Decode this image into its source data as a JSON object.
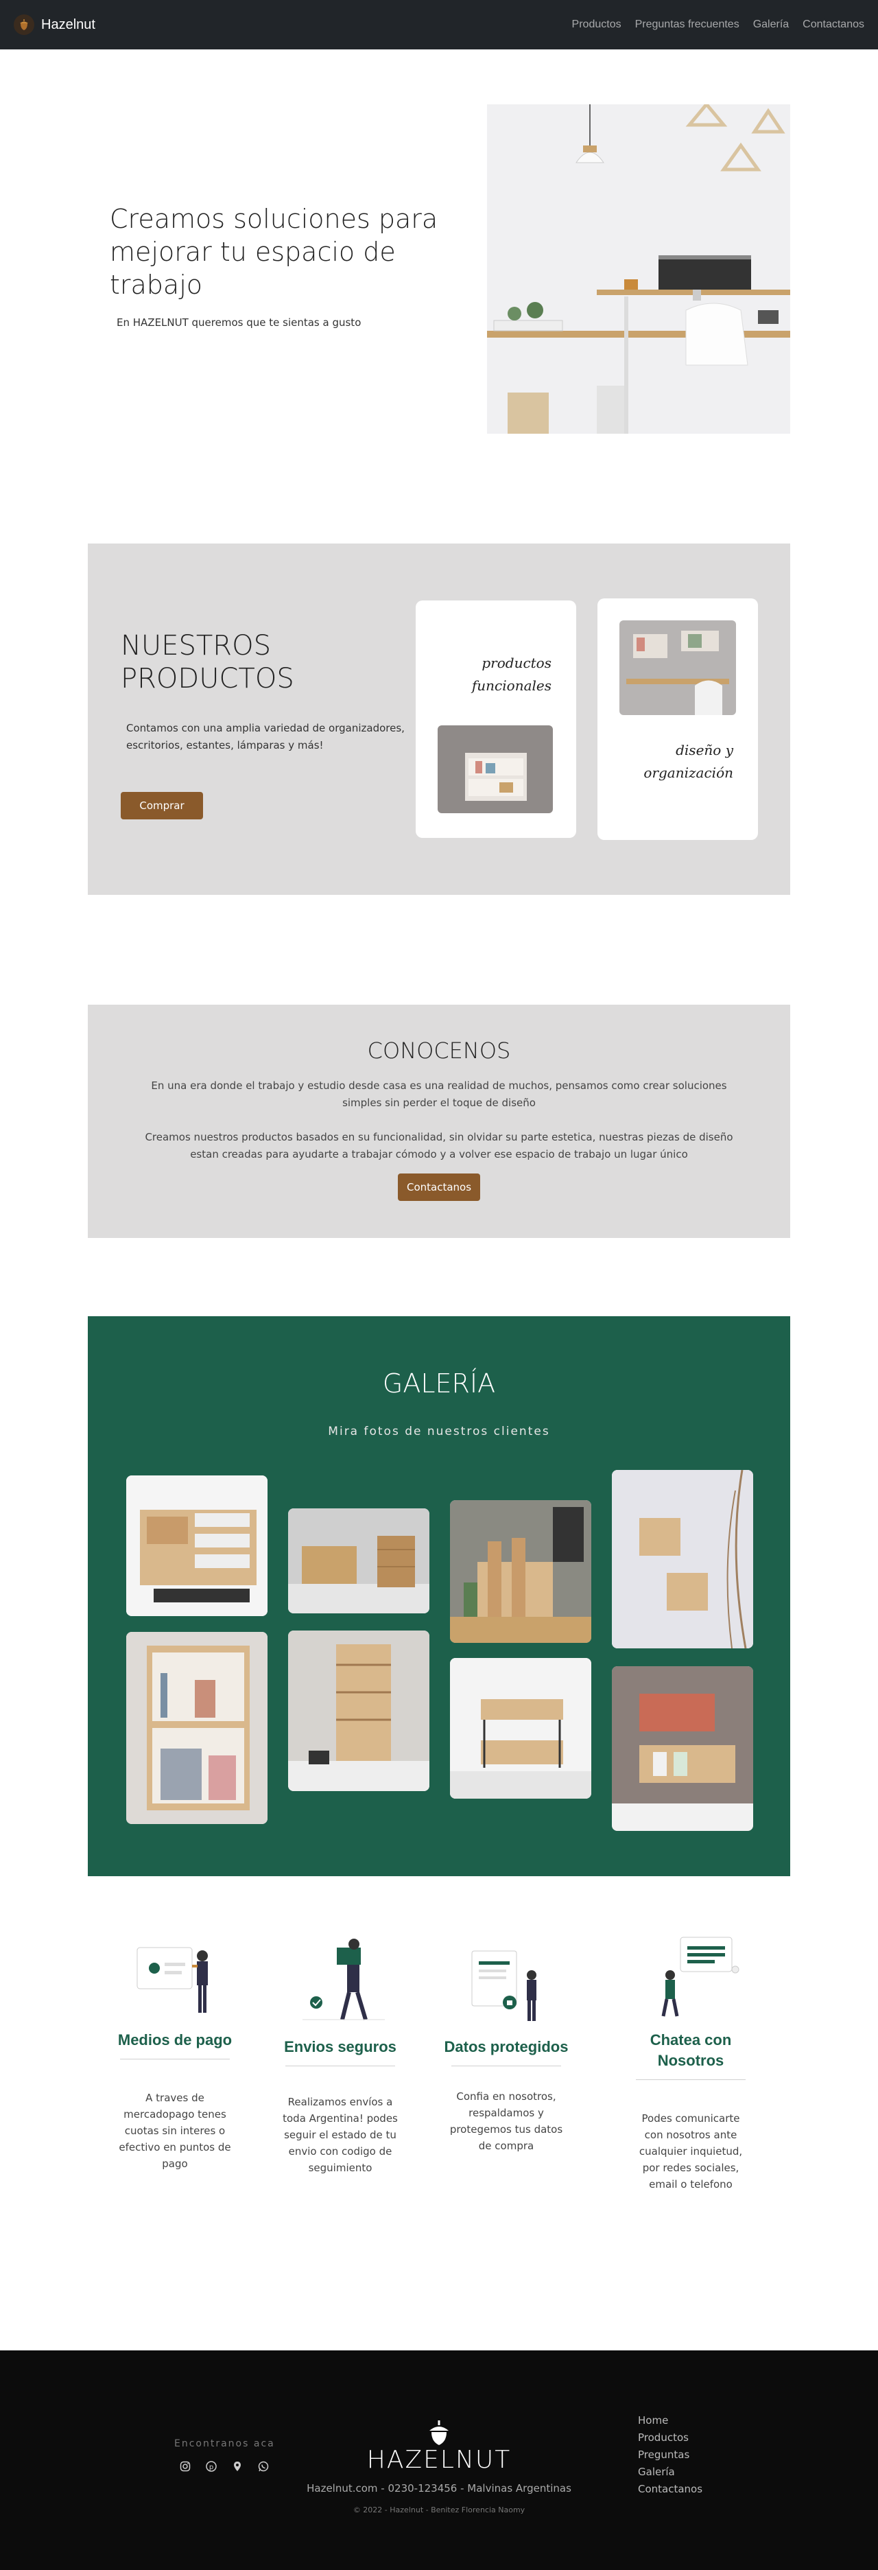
{
  "navbar": {
    "brand": "Hazelnut",
    "links": [
      "Productos",
      "Preguntas frecuentes",
      "Galería",
      "Contactanos"
    ]
  },
  "hero": {
    "title": "Creamos soluciones para mejorar tu espacio de trabajo",
    "subtitle": "En HAZELNUT queremos que te sientas a gusto"
  },
  "products": {
    "title": "NUESTROS PRODUCTOS",
    "text": "Contamos con una amplia variedad de organizadores, escritorios, estantes, lámparas y más!",
    "button": "Comprar",
    "card1_label": "productos funcionales",
    "card2_label": "diseño y organización"
  },
  "about": {
    "title": "CONOCENOS",
    "p1": "En una era donde el trabajo y estudio desde casa es una realidad de muchos, pensamos como crear soluciones simples sin perder el toque de diseño",
    "p2": "Creamos nuestros productos basados en su funcionalidad, sin olvidar su parte estetica, nuestras piezas de diseño estan creadas para ayudarte a trabajar cómodo y a volver ese espacio de trabajo un lugar único",
    "button": "Contactanos"
  },
  "gallery": {
    "title": "GALERÍA",
    "subtitle": "Mira fotos de nuestros clientes"
  },
  "features": [
    {
      "title": "Medios de pago",
      "text": "A traves de mercadopago tenes cuotas sin interes o efectivo en puntos de pago"
    },
    {
      "title": "Envios seguros",
      "text": "Realizamos envíos a toda Argentina! podes seguir el estado de tu envio con codigo de seguimiento"
    },
    {
      "title": "Datos protegidos",
      "text": "Confia en nosotros, respaldamos y protegemos tus datos de compra"
    },
    {
      "title": "Chatea con Nosotros",
      "text": "Podes comunicarte con nosotros ante cualquier inquietud, por redes sociales, email o telefono"
    }
  ],
  "footer": {
    "find": "Encontranos aca",
    "social_icons": [
      "instagram-icon",
      "pinterest-icon",
      "location-icon",
      "whatsapp-icon"
    ],
    "brand": "HAZELNUT",
    "line": "Hazelnut.com - 0230-123456 - Malvinas Argentinas",
    "copy": "© 2022 - Hazelnut - Benitez Florencia Naomy",
    "links": [
      "Home",
      "Productos",
      "Preguntas",
      "Galería",
      "Contactanos"
    ]
  },
  "colors": {
    "navbar": "#212529",
    "brown_button": "#8a5a2b",
    "gallery_bg": "#1d604b",
    "section_grey": "#dddcdc",
    "footer_bg": "#0c0c0c"
  }
}
